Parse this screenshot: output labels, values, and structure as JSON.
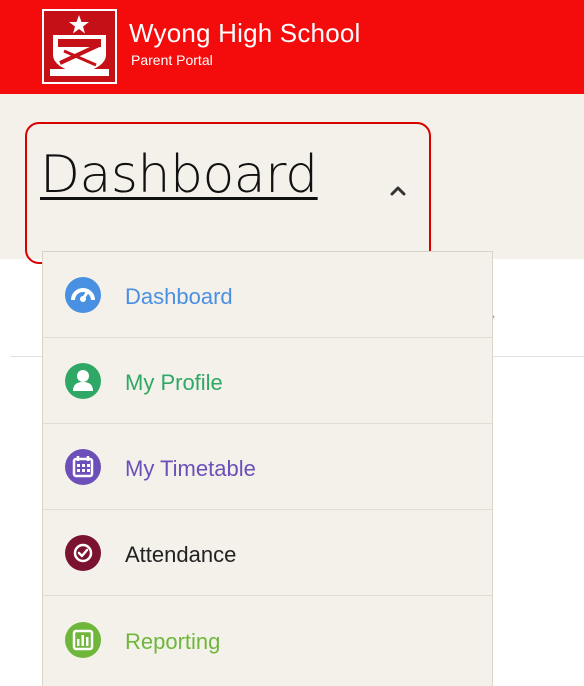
{
  "header": {
    "school_name": "Wyong High School",
    "portal_name": "Parent Portal",
    "crest_text": "W.H.S",
    "crest_motto": "NOTHING DOING"
  },
  "page": {
    "title": "Dashboard"
  },
  "colors": {
    "header_red": "#f40b0b",
    "dashboard": "#4a90e2",
    "profile": "#2fa866",
    "timetable": "#6c4fb8",
    "attendance": "#7a1230",
    "reporting": "#6fb73b"
  },
  "menu": {
    "items": [
      {
        "label": "Dashboard",
        "icon": "speedometer-icon",
        "color": "#4a90e2"
      },
      {
        "label": "My Profile",
        "icon": "person-icon",
        "color": "#2fa866"
      },
      {
        "label": "My Timetable",
        "icon": "calendar-icon",
        "color": "#6c4fb8"
      },
      {
        "label": "Attendance",
        "icon": "check-circle-icon",
        "color": "#7a1230"
      },
      {
        "label": "Reporting",
        "icon": "bar-chart-icon",
        "color": "#6fb73b"
      }
    ]
  }
}
